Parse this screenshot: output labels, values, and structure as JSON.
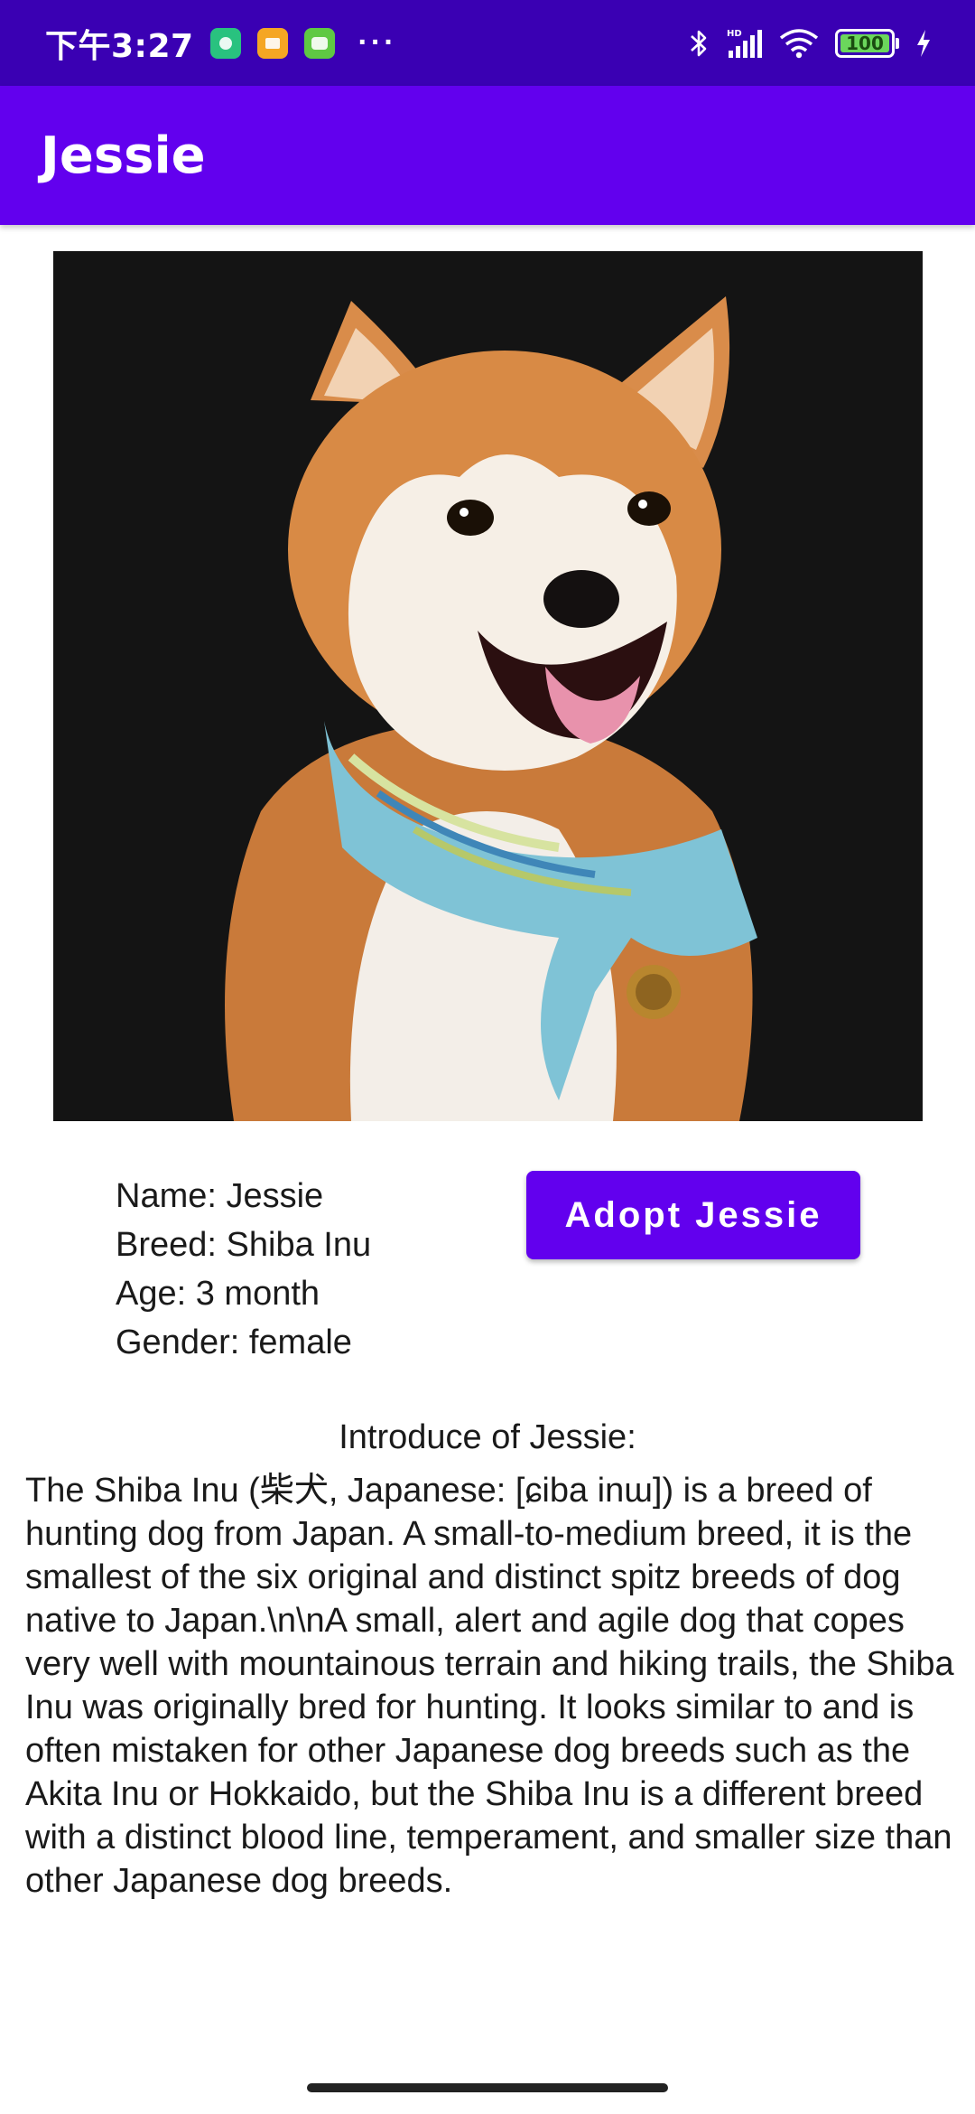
{
  "status_bar": {
    "time": "下午3:27",
    "more": "···",
    "battery_level": "100",
    "network_label": "HD"
  },
  "app_bar": {
    "title": "Jessie"
  },
  "details": {
    "name": "Name: Jessie",
    "breed": "Breed: Shiba Inu",
    "age": "Age: 3 month",
    "gender": "Gender: female"
  },
  "adopt_button_label": "Adopt Jessie",
  "intro": {
    "title": "Introduce of Jessie:",
    "body": "The Shiba Inu (柴犬, Japanese: [ɕiba inɯ]) is a breed of hunting dog from Japan. A small-to-medium breed, it is the smallest of the six original and distinct spitz breeds of dog native to Japan.\\n\\nA small, alert and agile dog that copes very well with mountainous terrain and hiking trails, the Shiba Inu was originally bred for hunting. It looks similar to and is often mistaken for other Japanese dog breeds such as the Akita Inu or Hokkaido, but the Shiba Inu is a different breed with a distinct blood line, temperament, and smaller size than other Japanese dog breeds."
  },
  "colors": {
    "status_bar": "#3a00b3",
    "app_bar": "#6200ee",
    "button": "#6200ee",
    "photo_background": "#141414"
  }
}
